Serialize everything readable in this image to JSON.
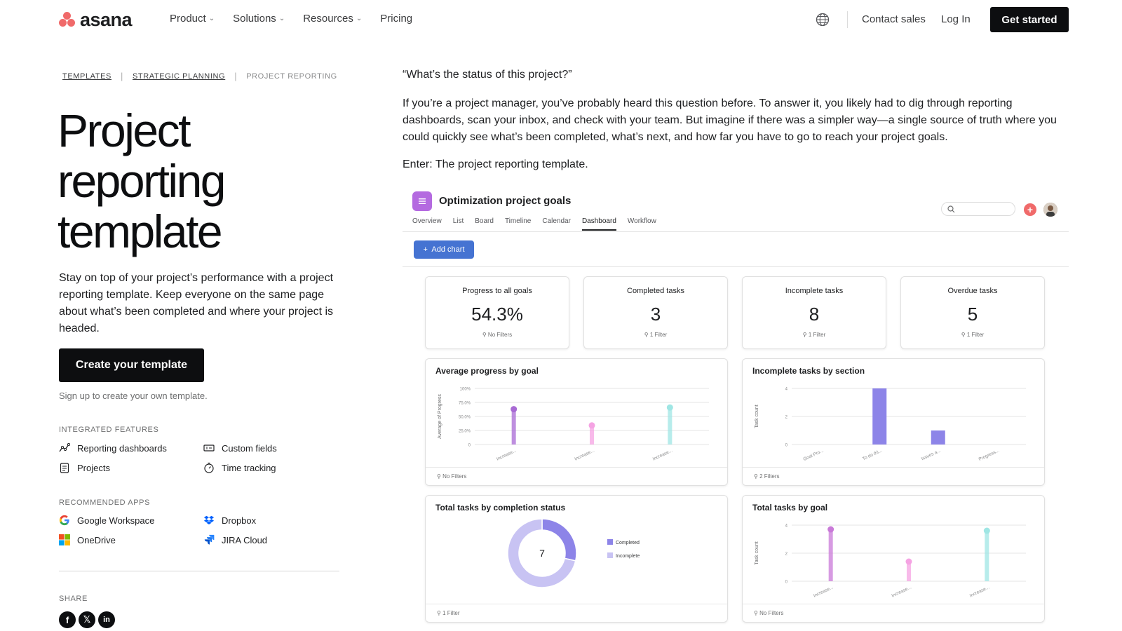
{
  "nav": {
    "logo_text": "asana",
    "links": [
      {
        "label": "Product",
        "dropdown": true
      },
      {
        "label": "Solutions",
        "dropdown": true
      },
      {
        "label": "Resources",
        "dropdown": true
      },
      {
        "label": "Pricing",
        "dropdown": false
      }
    ],
    "contact_sales": "Contact sales",
    "login": "Log In",
    "get_started": "Get started"
  },
  "breadcrumb": {
    "items": [
      "TEMPLATES",
      "STRATEGIC PLANNING"
    ],
    "current": "PROJECT REPORTING"
  },
  "hero": {
    "title": "Project reporting template",
    "description": "Stay on top of your project’s performance with a project reporting template. Keep everyone on the same page about what’s been completed and where your project is headed.",
    "cta": "Create your template",
    "signup_note": "Sign up to create your own template."
  },
  "integrated_features": {
    "label": "INTEGRATED FEATURES",
    "items": [
      "Reporting dashboards",
      "Custom fields",
      "Projects",
      "Time tracking"
    ]
  },
  "recommended_apps": {
    "label": "RECOMMENDED APPS",
    "items": [
      "Google Workspace",
      "Dropbox",
      "OneDrive",
      "JIRA Cloud"
    ]
  },
  "share": {
    "label": "SHARE"
  },
  "content": {
    "quote": "“What’s the status of this project?”",
    "intro": "If you’re a project manager, you’ve probably heard this question before. To answer it, you likely had to dig through reporting dashboards, scan your inbox, and check with your team. But imagine if there was a simpler way—a single source of truth where you could quickly see what’s been completed, what’s next, and how far you have to go to reach your project goals.",
    "enter": "Enter: The project reporting template."
  },
  "mock": {
    "project_title": "Optimization project goals",
    "tabs": [
      "Overview",
      "List",
      "Board",
      "Timeline",
      "Calendar",
      "Dashboard",
      "Workflow"
    ],
    "active_tab": "Dashboard",
    "add_chart": "Add chart",
    "kpis": [
      {
        "label": "Progress to all goals",
        "value": "54.3%",
        "filter": "No Filters"
      },
      {
        "label": "Completed tasks",
        "value": "3",
        "filter": "1 Filter"
      },
      {
        "label": "Incomplete tasks",
        "value": "8",
        "filter": "1 Filter"
      },
      {
        "label": "Overdue tasks",
        "value": "5",
        "filter": "1 Filter"
      }
    ],
    "charts": [
      {
        "title": "Average progress by goal",
        "filter": "No Filters"
      },
      {
        "title": "Incomplete tasks by section",
        "filter": "2 Filters"
      },
      {
        "title": "Total tasks by completion status",
        "filter": "1 Filter"
      },
      {
        "title": "Total tasks by goal",
        "filter": "No Filters"
      }
    ]
  },
  "chart_data": [
    {
      "type": "scatter",
      "title": "Average progress by goal",
      "ylabel": "Average of Progress",
      "categories": [
        "Increase...",
        "Increase...",
        "Increase..."
      ],
      "y_ticks": [
        "0",
        "25.0%",
        "50.0%",
        "75.0%",
        "100%"
      ],
      "ylim": [
        0,
        100
      ],
      "values": [
        63,
        34,
        66
      ],
      "colors": [
        "#a86ad4",
        "#f5a3e3",
        "#9fe6e4"
      ],
      "filter": "No Filters"
    },
    {
      "type": "bar",
      "title": "Incomplete tasks by section",
      "ylabel": "Task count",
      "categories": [
        "Goal Pro...",
        "To do thi...",
        "Issues a...",
        "Progress..."
      ],
      "y_ticks": [
        "0",
        "2",
        "4"
      ],
      "ylim": [
        0,
        4
      ],
      "values": [
        0,
        4,
        1,
        0
      ],
      "color": "#8d84e8",
      "filter": "2 Filters"
    },
    {
      "type": "pie",
      "title": "Total tasks by completion status",
      "center_label": "7",
      "series": [
        {
          "name": "Completed",
          "value": 2,
          "color": "#8d84e8"
        },
        {
          "name": "Incomplete",
          "value": 5,
          "color": "#c8c3f3"
        }
      ],
      "filter": "1 Filter"
    },
    {
      "type": "scatter",
      "title": "Total tasks by goal",
      "ylabel": "Task count",
      "categories": [
        "Increase...",
        "Increase...",
        "Increase..."
      ],
      "y_ticks": [
        "0",
        "2",
        "4"
      ],
      "ylim": [
        0,
        4
      ],
      "values": [
        3.7,
        1.4,
        3.6
      ],
      "colors": [
        "#c97ad8",
        "#f5a3e3",
        "#9fe6e4"
      ],
      "filter": "No Filters"
    }
  ]
}
